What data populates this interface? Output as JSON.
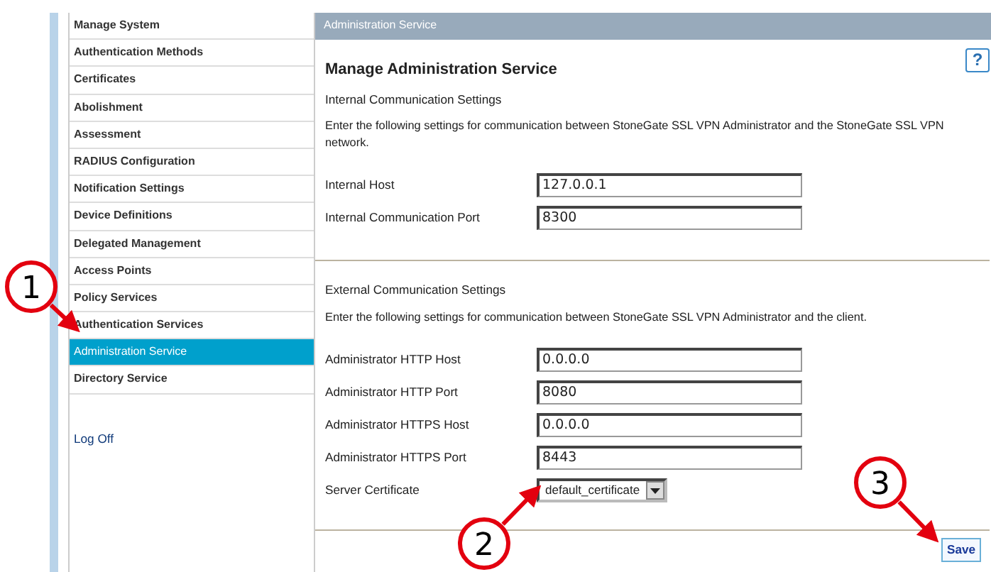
{
  "sidebar": {
    "items": [
      {
        "label": "Manage System",
        "selected": false
      },
      {
        "label": "Authentication Methods",
        "selected": false
      },
      {
        "label": "Certificates",
        "selected": false
      },
      {
        "label": "Abolishment",
        "selected": false
      },
      {
        "label": "Assessment",
        "selected": false
      },
      {
        "label": "RADIUS Configuration",
        "selected": false
      },
      {
        "label": "Notification Settings",
        "selected": false
      },
      {
        "label": "Device Definitions",
        "selected": false
      },
      {
        "label": "Delegated Management",
        "selected": false
      },
      {
        "label": "Access Points",
        "selected": false
      },
      {
        "label": "Policy Services",
        "selected": false
      },
      {
        "label": "Authentication Services",
        "selected": false
      },
      {
        "label": "Administration Service",
        "selected": true
      },
      {
        "label": "Directory Service",
        "selected": false
      }
    ],
    "logoff": "Log Off"
  },
  "panel": {
    "header": "Administration Service",
    "title": "Manage Administration Service",
    "help": "?",
    "sections": [
      {
        "heading": "Internal Communication Settings",
        "description": "Enter the following settings for communication between StoneGate SSL VPN Administrator and the StoneGate SSL VPN network.",
        "fields": [
          {
            "label": "Internal Host",
            "kind": "text",
            "value": "127.0.0.1"
          },
          {
            "label": "Internal Communication Port",
            "kind": "text",
            "value": "8300"
          }
        ]
      },
      {
        "heading": "External Communication Settings",
        "description": "Enter the following settings for communication between StoneGate SSL VPN Administrator and the client.",
        "fields": [
          {
            "label": "Administrator HTTP Host",
            "kind": "text",
            "value": "0.0.0.0"
          },
          {
            "label": "Administrator HTTP Port",
            "kind": "text",
            "value": "8080"
          },
          {
            "label": "Administrator HTTPS Host",
            "kind": "text",
            "value": "0.0.0.0"
          },
          {
            "label": "Administrator HTTPS Port",
            "kind": "text",
            "value": "8443"
          },
          {
            "label": "Server Certificate",
            "kind": "select",
            "value": "default_certificate"
          }
        ]
      }
    ],
    "save": "Save"
  },
  "callouts": [
    "1",
    "2",
    "3"
  ]
}
